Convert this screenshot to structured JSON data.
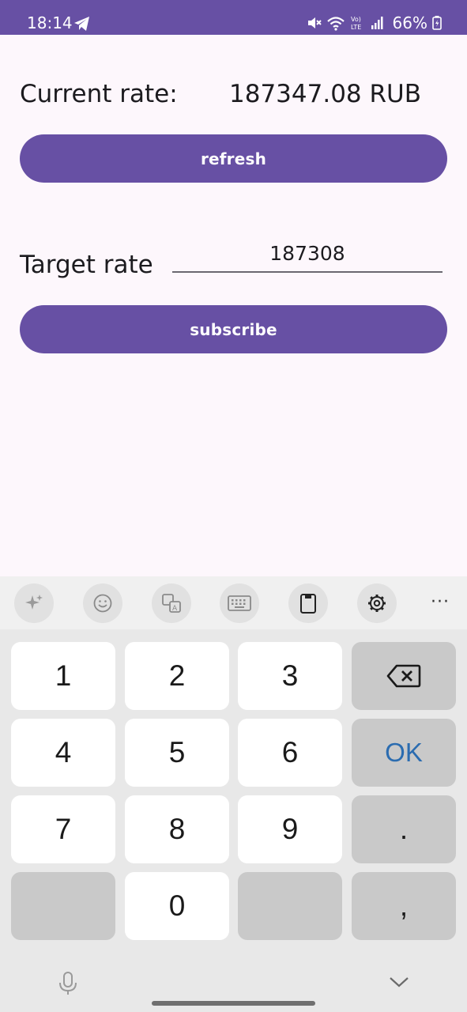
{
  "status_bar": {
    "time": "18:14",
    "battery": "66%",
    "icons": [
      "telegram-icon",
      "mute-icon",
      "wifi-icon",
      "volte-icon",
      "signal-icon",
      "battery-icon"
    ]
  },
  "main": {
    "current_rate_label": "Current rate:",
    "current_rate_value": "187347.08 RUB",
    "refresh_label": "refresh",
    "target_rate_label": "Target rate",
    "target_rate_value": "187308",
    "subscribe_label": "subscribe"
  },
  "keyboard": {
    "toolbar": [
      "ai-sparkle-icon",
      "emoji-icon",
      "translate-icon",
      "keyboard-icon",
      "clipboard-icon",
      "settings-icon",
      "more-icon"
    ],
    "more_label": "···",
    "keys": {
      "k1": "1",
      "k2": "2",
      "k3": "3",
      "k4": "4",
      "k5": "5",
      "k6": "6",
      "k7": "7",
      "k8": "8",
      "k9": "9",
      "k0": "0",
      "ok": "OK",
      "dot": ".",
      "comma": ","
    }
  },
  "colors": {
    "primary": "#6750a4",
    "background": "#fdf7fc",
    "ok_text": "#2b6cb0"
  }
}
